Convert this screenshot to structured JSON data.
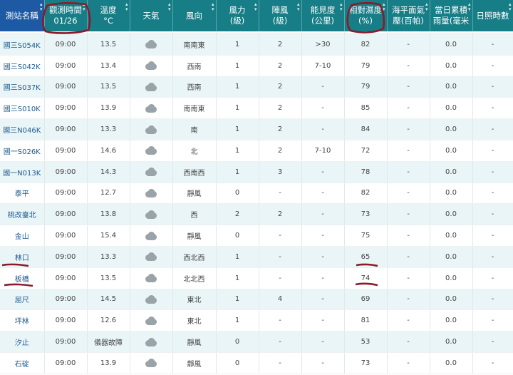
{
  "headers": [
    {
      "lines": [
        "測站名稱"
      ],
      "sortable": true
    },
    {
      "lines": [
        "觀測時間",
        "01/26"
      ],
      "sortable": true
    },
    {
      "lines": [
        "溫度",
        "°C"
      ],
      "sortable": true
    },
    {
      "lines": [
        "天氣"
      ],
      "sortable": true
    },
    {
      "lines": [
        "風向"
      ],
      "sortable": true
    },
    {
      "lines": [
        "風力",
        "(級)"
      ],
      "sortable": true
    },
    {
      "lines": [
        "陣風",
        "(級)"
      ],
      "sortable": true
    },
    {
      "lines": [
        "能見度",
        "(公里)"
      ],
      "sortable": true
    },
    {
      "lines": [
        "相對濕度",
        "(%)"
      ],
      "sortable": true
    },
    {
      "lines": [
        "海平面氣",
        "壓(百帕)"
      ],
      "sortable": true
    },
    {
      "lines": [
        "當日累積",
        "雨量(毫米"
      ],
      "sortable": true
    },
    {
      "lines": [
        "日照時數"
      ],
      "sortable": true
    }
  ],
  "weather_icon": "cloud-icon",
  "rows": [
    [
      "國三S054K",
      "09:00",
      "13.5",
      "",
      "南南東",
      "1",
      "2",
      ">30",
      "82",
      "-",
      "0.0",
      "-"
    ],
    [
      "國三S042K",
      "09:00",
      "13.4",
      "",
      "西南",
      "1",
      "2",
      "7-10",
      "79",
      "-",
      "0.0",
      "-"
    ],
    [
      "國三S037K",
      "09:00",
      "13.5",
      "",
      "西南",
      "1",
      "2",
      "-",
      "79",
      "-",
      "0.0",
      "-"
    ],
    [
      "國三S010K",
      "09:00",
      "13.9",
      "",
      "南南東",
      "1",
      "2",
      "-",
      "85",
      "-",
      "0.0",
      "-"
    ],
    [
      "國三N046K",
      "09:00",
      "13.3",
      "",
      "南",
      "1",
      "2",
      "-",
      "84",
      "-",
      "0.0",
      "-"
    ],
    [
      "國一S026K",
      "09:00",
      "14.6",
      "",
      "北",
      "1",
      "2",
      "7-10",
      "72",
      "-",
      "0.0",
      "-"
    ],
    [
      "國一N013K",
      "09:00",
      "14.3",
      "",
      "西南西",
      "1",
      "3",
      "-",
      "78",
      "-",
      "0.0",
      "-"
    ],
    [
      "泰平",
      "09:00",
      "12.7",
      "",
      "靜風",
      "0",
      "-",
      "-",
      "82",
      "-",
      "0.0",
      "-"
    ],
    [
      "桃改臺北",
      "09:00",
      "13.8",
      "",
      "西",
      "2",
      "2",
      "-",
      "73",
      "-",
      "0.0",
      "-"
    ],
    [
      "金山",
      "09:00",
      "15.4",
      "",
      "靜風",
      "0",
      "-",
      "-",
      "75",
      "-",
      "0.0",
      "-"
    ],
    [
      "林口",
      "09:00",
      "13.3",
      "",
      "西北西",
      "1",
      "-",
      "-",
      "65",
      "-",
      "0.0",
      "-"
    ],
    [
      "板橋",
      "09:00",
      "13.5",
      "",
      "北北西",
      "1",
      "-",
      "-",
      "74",
      "-",
      "0.0",
      "-"
    ],
    [
      "屈尺",
      "09:00",
      "14.5",
      "",
      "東北",
      "1",
      "4",
      "-",
      "69",
      "-",
      "0.0",
      "-"
    ],
    [
      "坪林",
      "09:00",
      "12.6",
      "",
      "東北",
      "1",
      "-",
      "-",
      "81",
      "-",
      "0.0",
      "-"
    ],
    [
      "汐止",
      "09:00",
      "儀器故障",
      "",
      "靜風",
      "0",
      "-",
      "-",
      "53",
      "-",
      "0.0",
      "-"
    ],
    [
      "石碇",
      "09:00",
      "13.9",
      "",
      "靜風",
      "0",
      "-",
      "-",
      "73",
      "-",
      "0.0",
      "-"
    ]
  ],
  "annotation_color": "#8b1a2b"
}
